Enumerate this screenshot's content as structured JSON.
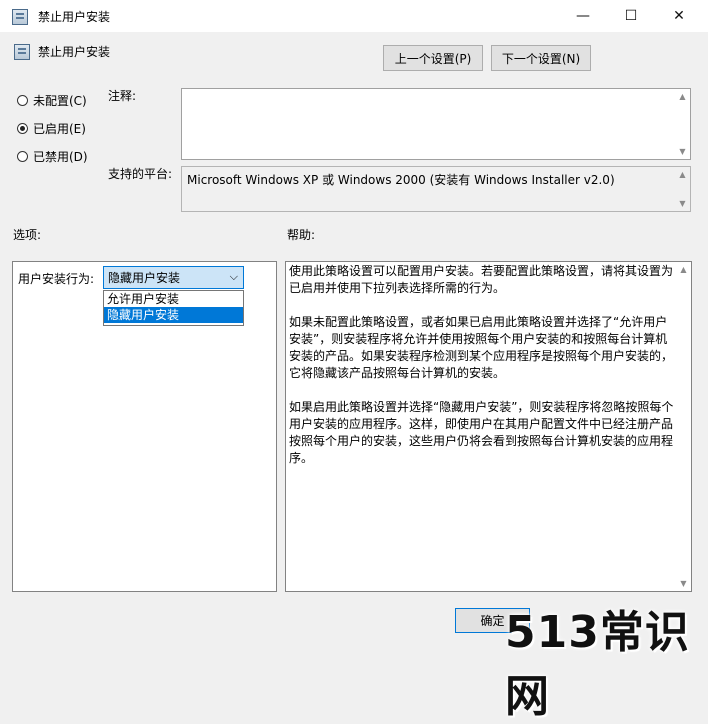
{
  "window": {
    "title": "禁止用户安装",
    "minimize": "—",
    "maximize": "☐",
    "close": "✕"
  },
  "policy": {
    "name": "禁止用户安装"
  },
  "nav": {
    "prev_label": "上一个设置(P)",
    "next_label": "下一个设置(N)"
  },
  "state_options": [
    {
      "label": "未配置(C)",
      "checked": false
    },
    {
      "label": "已启用(E)",
      "checked": true
    },
    {
      "label": "已禁用(D)",
      "checked": false
    }
  ],
  "comment": {
    "label": "注释:",
    "value": ""
  },
  "platform": {
    "label": "支持的平台:",
    "value": "Microsoft Windows XP 或 Windows 2000 (安装有 Windows Installer v2.0)"
  },
  "options": {
    "header": "选项:",
    "behavior_label": "用户安装行为:",
    "selected": "隐藏用户安装",
    "dropdown_items": [
      "允许用户安装",
      "隐藏用户安装"
    ]
  },
  "help": {
    "header": "帮助:",
    "paragraphs": [
      "使用此策略设置可以配置用户安装。若要配置此策略设置，请将其设置为已启用并使用下拉列表选择所需的行为。",
      "如果未配置此策略设置，或者如果已启用此策略设置并选择了“允许用户安装”，则安装程序将允许并使用按照每个用户安装的和按照每台计算机安装的产品。如果安装程序检测到某个应用程序是按照每个用户安装的，它将隐藏该产品按照每台计算机的安装。",
      "如果启用此策略设置并选择“隐藏用户安装”，则安装程序将忽略按照每个用户安装的应用程序。这样，即使用户在其用户配置文件中已经注册产品按照每个用户的安装，这些用户仍将会看到按照每台计算机安装的应用程序。"
    ]
  },
  "footer": {
    "ok_label": "确定"
  },
  "watermark": "513常识网"
}
